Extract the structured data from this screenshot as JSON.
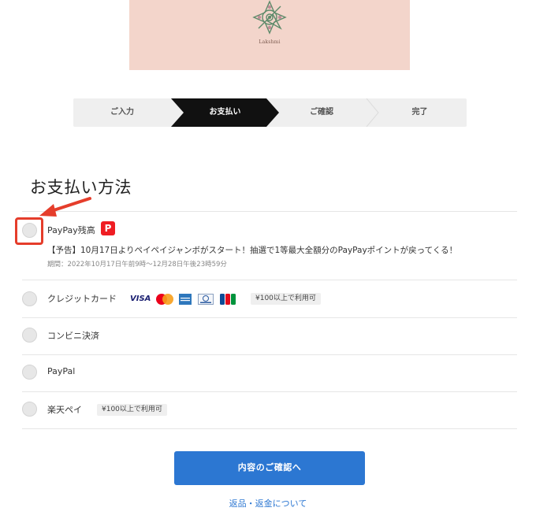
{
  "banner": {
    "brand_text": "Lakshmi"
  },
  "steps": [
    {
      "label": "ご入力",
      "active": false
    },
    {
      "label": "お支払い",
      "active": true
    },
    {
      "label": "ご確認",
      "active": false
    },
    {
      "label": "完了",
      "active": false
    }
  ],
  "payment": {
    "heading": "お支払い方法",
    "options": [
      {
        "label": "PayPay残高",
        "selected": false
      },
      {
        "label": "クレジットカード",
        "selected": false,
        "badge": "¥100以上で利用可"
      },
      {
        "label": "コンビニ決済",
        "selected": false
      },
      {
        "label": "PayPal",
        "selected": false
      },
      {
        "label": "楽天ペイ",
        "selected": false,
        "badge": "¥100以上で利用可"
      }
    ],
    "paypay_promo": "【予告】10月17日よりペイペイジャンボがスタート！抽選で1等最大全額分のPayPayポイントが戻ってくる！",
    "paypay_period": "期間：2022年10月17日午前9時〜12月28日午後23時59分",
    "paypay_logo_glyph": "P",
    "card_brands": [
      "visa",
      "mastercard",
      "amex",
      "diners",
      "jcb"
    ],
    "visa_text": "VISA"
  },
  "actions": {
    "submit_label": "内容のご確認へ",
    "returns_link": "返品・返金について"
  },
  "colors": {
    "banner_bg": "#f3d5cb",
    "step_active_bg": "#111111",
    "step_inactive_bg": "#efefef",
    "primary_button": "#2c77d2",
    "highlight_red": "#e53d2b",
    "paypay_red": "#ef1d23"
  }
}
